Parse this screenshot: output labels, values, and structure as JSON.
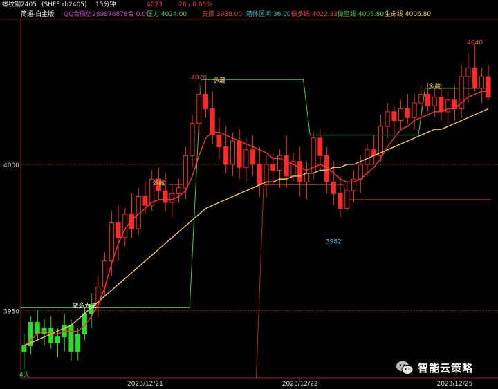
{
  "header": {
    "symbol": "螺纹钢2405",
    "code": "(SHFE rb2405)",
    "period": "15分钟",
    "last": "4023",
    "change": "26 / 0.65%"
  },
  "indicator_bar": {
    "template": "简通-白金版",
    "qq": "QQ合微信289876878合 0.00",
    "items": [
      {
        "label": "压力",
        "value": "4024.00",
        "color": "#3cd23c"
      },
      {
        "label": "支撑",
        "value": "3988.00",
        "color": "#e03c3c"
      },
      {
        "label": "箱体区间",
        "value": "36.00",
        "color": "#20c8d0"
      },
      {
        "label": "做多线",
        "value": "4022.33",
        "color": "#ff3030"
      },
      {
        "label": "做空线",
        "value": "4006.80",
        "color": "#3cd23c"
      },
      {
        "label": "生命线",
        "value": "4006.80",
        "color": "#f0d050"
      }
    ]
  },
  "chart_data": {
    "type": "candlestick",
    "y_ticks": [
      3950,
      4000
    ],
    "x_ticks": [
      "2023/12/21",
      "2023/12/22",
      "2023/12/25"
    ],
    "bar_annotation_left": "4天",
    "annotations": [
      {
        "text": "4028",
        "color": "#ff4040",
        "x_index": 26,
        "y": 4029
      },
      {
        "text": "多藏",
        "color": "#f0d050",
        "x_index": 29,
        "y": 4028
      },
      {
        "text": "多藏",
        "color": "#f0d050",
        "x_index": 20,
        "y": 3993
      },
      {
        "text": "做多为主",
        "color": "#f0f0f0",
        "x_index": 9,
        "y": 3951
      },
      {
        "text": "3982",
        "color": "#40c0e0",
        "x_index": 46,
        "y": 3973
      },
      {
        "text": "多藏",
        "color": "#f0d050",
        "x_index": 61,
        "y": 4026
      },
      {
        "text": "4040",
        "color": "#ff4040",
        "x_index": 67,
        "y": 4041
      }
    ],
    "candles": [
      [
        3936,
        3942,
        3930,
        3938
      ],
      [
        3938,
        3948,
        3935,
        3946
      ],
      [
        3946,
        3950,
        3940,
        3942
      ],
      [
        3942,
        3947,
        3938,
        3944
      ],
      [
        3944,
        3948,
        3937,
        3939
      ],
      [
        3939,
        3944,
        3934,
        3941
      ],
      [
        3941,
        3949,
        3936,
        3945
      ],
      [
        3945,
        3947,
        3933,
        3936
      ],
      [
        3936,
        3944,
        3933,
        3942
      ],
      [
        3942,
        3951,
        3940,
        3949
      ],
      [
        3949,
        3956,
        3944,
        3952
      ],
      [
        3952,
        3962,
        3948,
        3958
      ],
      [
        3958,
        3970,
        3955,
        3967
      ],
      [
        3967,
        3984,
        3962,
        3980
      ],
      [
        3980,
        3986,
        3967,
        3975
      ],
      [
        3975,
        3985,
        3972,
        3983
      ],
      [
        3983,
        3990,
        3975,
        3978
      ],
      [
        3978,
        3992,
        3976,
        3989
      ],
      [
        3989,
        3994,
        3983,
        3986
      ],
      [
        3986,
        3998,
        3984,
        3995
      ],
      [
        3995,
        3999,
        3988,
        3991
      ],
      [
        3991,
        3997,
        3984,
        3987
      ],
      [
        3987,
        3993,
        3982,
        3990
      ],
      [
        3990,
        3995,
        3987,
        3992
      ],
      [
        3992,
        4006,
        3988,
        4003
      ],
      [
        4003,
        4017,
        3999,
        4014
      ],
      [
        4014,
        4028,
        4010,
        4024
      ],
      [
        4024,
        4029,
        4016,
        4019
      ],
      [
        4019,
        4025,
        4007,
        4010
      ],
      [
        4010,
        4016,
        4002,
        4006
      ],
      [
        4006,
        4013,
        3997,
        4000
      ],
      [
        4000,
        4011,
        3996,
        4008
      ],
      [
        4008,
        4012,
        3995,
        3999
      ],
      [
        3999,
        4009,
        3994,
        4005
      ],
      [
        4005,
        4010,
        3996,
        4000
      ],
      [
        4000,
        4006,
        3989,
        3993
      ],
      [
        3993,
        4003,
        3989,
        4000
      ],
      [
        4000,
        4004,
        3993,
        3998
      ],
      [
        3998,
        4005,
        3992,
        4003
      ],
      [
        4003,
        4010,
        3992,
        3996
      ],
      [
        3996,
        4004,
        3994,
        4001
      ],
      [
        4001,
        4006,
        3989,
        3994
      ],
      [
        3994,
        4001,
        3988,
        3997
      ],
      [
        3997,
        4011,
        3995,
        4009
      ],
      [
        4009,
        4012,
        3998,
        4003
      ],
      [
        4003,
        4006,
        3990,
        3994
      ],
      [
        3994,
        4001,
        3986,
        3990
      ],
      [
        3990,
        3996,
        3982,
        3985
      ],
      [
        3985,
        3994,
        3984,
        3991
      ],
      [
        3991,
        3998,
        3987,
        3995
      ],
      [
        3995,
        4003,
        3990,
        4000
      ],
      [
        4000,
        4007,
        3996,
        4005
      ],
      [
        4005,
        4010,
        4000,
        4003
      ],
      [
        4003,
        4017,
        4001,
        4013
      ],
      [
        4013,
        4021,
        4009,
        4018
      ],
      [
        4018,
        4020,
        4010,
        4015
      ],
      [
        4015,
        4022,
        4012,
        4019
      ],
      [
        4019,
        4024,
        4014,
        4016
      ],
      [
        4016,
        4024,
        4012,
        4021
      ],
      [
        4021,
        4027,
        4016,
        4024
      ],
      [
        4024,
        4028,
        4018,
        4020
      ],
      [
        4020,
        4026,
        4016,
        4023
      ],
      [
        4023,
        4027,
        4015,
        4018
      ],
      [
        4018,
        4025,
        4014,
        4022
      ],
      [
        4022,
        4027,
        4015,
        4019
      ],
      [
        4019,
        4034,
        4016,
        4030
      ],
      [
        4030,
        4038,
        4021,
        4033
      ],
      [
        4033,
        4041,
        4025,
        4026
      ],
      [
        4026,
        4033,
        4021,
        4030
      ],
      [
        4030,
        4034,
        4022,
        4023
      ]
    ],
    "series": [
      {
        "name": "生命线",
        "color": "#f5c842",
        "values": [
          3938,
          3939,
          3940,
          3941,
          3942,
          3943,
          3944,
          3945,
          3947,
          3949,
          3951,
          3953,
          3955,
          3957,
          3959,
          3961,
          3963,
          3965,
          3967,
          3969,
          3971,
          3973,
          3975,
          3977,
          3979,
          3981,
          3983,
          3985,
          3986,
          3987,
          3988,
          3989,
          3990,
          3991,
          3992,
          3993,
          3994,
          3994,
          3995,
          3995,
          3996,
          3996,
          3997,
          3997,
          3998,
          3998,
          3999,
          3999,
          4000,
          4000,
          4001,
          4002,
          4003,
          4004,
          4005,
          4006,
          4007,
          4008,
          4009,
          4010,
          4011,
          4012,
          4012,
          4013,
          4014,
          4015,
          4016,
          4017,
          4018,
          4019
        ]
      },
      {
        "name": "做多线",
        "color": "#ff3030",
        "values": [
          3938,
          3940,
          3942,
          3943,
          3942,
          3942,
          3943,
          3943,
          3943,
          3945,
          3948,
          3952,
          3958,
          3966,
          3973,
          3978,
          3981,
          3983,
          3985,
          3987,
          3988,
          3988,
          3988,
          3989,
          3991,
          3996,
          4003,
          4009,
          4011,
          4011,
          4010,
          4009,
          4008,
          4007,
          4006,
          4005,
          4004,
          4002,
          4002,
          4001,
          4000,
          3999,
          3998,
          3999,
          4000,
          3999,
          3997,
          3995,
          3994,
          3994,
          3995,
          3997,
          3999,
          4002,
          4006,
          4009,
          4012,
          4013,
          4015,
          4016,
          4017,
          4018,
          4018,
          4019,
          4019,
          4021,
          4023,
          4024,
          4025,
          4025
        ]
      }
    ]
  }
}
